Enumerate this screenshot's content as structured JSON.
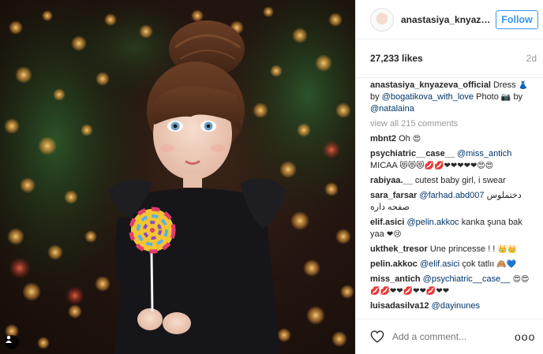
{
  "header": {
    "username": "anastasiya_knyazev...",
    "follow_label": "Follow"
  },
  "post": {
    "likes": "27,233 likes",
    "time": "2d"
  },
  "caption": {
    "username": "anastasiya_knyazeva_official",
    "text_1": "Dress",
    "emoji_1": "👗",
    "text_2": "by",
    "mention_1": "@bogatikova_with_love",
    "text_3": "Photo",
    "emoji_2": "📷",
    "text_4": "by",
    "mention_2": "@natalaina"
  },
  "view_all": "view all 215 comments",
  "comments": [
    {
      "user": "mbnt2",
      "text": "Oh",
      "mention": "",
      "emoji": "😍"
    },
    {
      "user": "psychiatric__case__",
      "mention": "@miss_antich",
      "text": "MICAA",
      "emoji": "😻😻😻💋💋❤❤❤❤❤😍😍"
    },
    {
      "user": "rabiyaa.__",
      "mention": "",
      "text": "cutest baby girl, i swear",
      "emoji": ""
    },
    {
      "user": "sara_farsar",
      "mention": "@farhad.abd007",
      "text": "دختملوس صفحه داره",
      "emoji": ""
    },
    {
      "user": "elif.asici",
      "mention": "@pelin.akkoc",
      "text": "kanka şuna bak yaa",
      "emoji": "❤😢"
    },
    {
      "user": "ukthek_tresor",
      "mention": "",
      "text": "Une princesse ! !",
      "emoji": "👑👑"
    },
    {
      "user": "pelin.akkoc",
      "mention": "@elif.asici",
      "text": "çok tatlıı",
      "emoji": "🙈💙"
    },
    {
      "user": "miss_antich",
      "mention": "@psychiatric__case__",
      "text": "",
      "emoji": "😍😍💋💋❤❤💋❤❤💋❤❤"
    },
    {
      "user": "luisadasilva12",
      "mention": "@dayinunes",
      "text": "",
      "emoji": ""
    }
  ],
  "footer": {
    "add_comment_placeholder": "Add a comment...",
    "more_label": "ooo"
  },
  "icons": {
    "heart": "heart-outline-icon",
    "tag": "person-tag-icon",
    "more": "more-options-icon"
  },
  "colors": {
    "follow": "#3897f0",
    "mention": "#003569",
    "muted": "#999999"
  }
}
